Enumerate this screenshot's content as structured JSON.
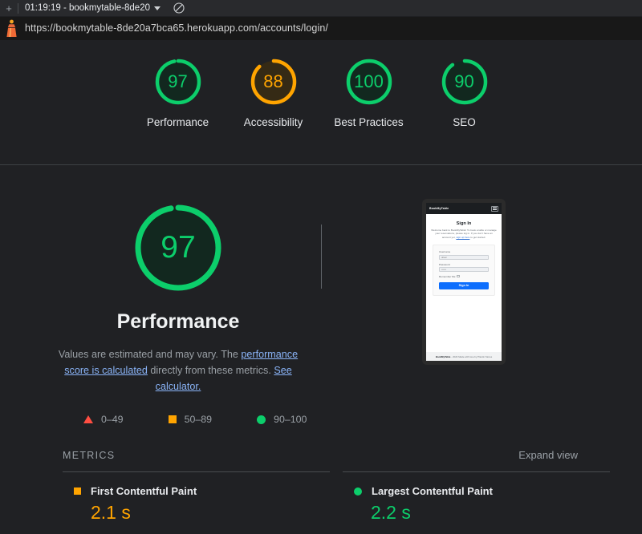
{
  "devtools": {
    "plus_label": "+",
    "run_selector": "01:19:19 - bookmytable-8de20",
    "clear_icon": "clear-circle-icon"
  },
  "url_bar": {
    "logo_icon": "lighthouse-icon",
    "url": "https://bookmytable-8de20a7bca65.herokuapp.com/accounts/login/"
  },
  "colors": {
    "pass": "#0cce6b",
    "average": "#ffa400",
    "fail": "#ff4e42",
    "background": "#202124",
    "link": "#8ab4f8"
  },
  "score_gauges": [
    {
      "label": "Performance",
      "score": 97,
      "rating": "pass"
    },
    {
      "label": "Accessibility",
      "score": 88,
      "rating": "average"
    },
    {
      "label": "Best Practices",
      "score": 100,
      "rating": "pass"
    },
    {
      "label": "SEO",
      "score": 90,
      "rating": "pass"
    }
  ],
  "category": {
    "score": 97,
    "title": "Performance",
    "description_part1": "Values are estimated and may vary. The ",
    "link1": "performance score is calculated",
    "description_part2": " directly from these metrics. ",
    "link2": "See calculator."
  },
  "legend": [
    {
      "shape": "triangle",
      "color": "#ff4e42",
      "range": "0–49"
    },
    {
      "shape": "square",
      "color": "#ffa400",
      "range": "50–89"
    },
    {
      "shape": "circle",
      "color": "#0cce6b",
      "range": "90–100"
    }
  ],
  "metrics_section": {
    "heading": "METRICS",
    "expand_view": "Expand view",
    "items": [
      {
        "name": "First Contentful Paint",
        "value": "2.1 s",
        "rating": "average"
      },
      {
        "name": "Largest Contentful Paint",
        "value": "2.2 s",
        "rating": "pass"
      }
    ]
  },
  "thumbnail": {
    "brand": "BookMyTable",
    "menu_icon": "hamburger-icon",
    "heading": "Sign In",
    "body_part1": "Welcome back to BookMyTable! To book a table or manage your reservations, please log in. If you don't have an account yet, ",
    "body_link": "sign up here",
    "body_part2": " to get started.",
    "username_label": "Username",
    "username_value": "olivar",
    "password_label": "Password",
    "password_value": "••••••",
    "remember_label": "Remember Me",
    "submit_label": "Sign In",
    "footer_bold": "BookMyTable",
    "footer_rest": " - 2024 Made with love by Plantin Stores"
  }
}
